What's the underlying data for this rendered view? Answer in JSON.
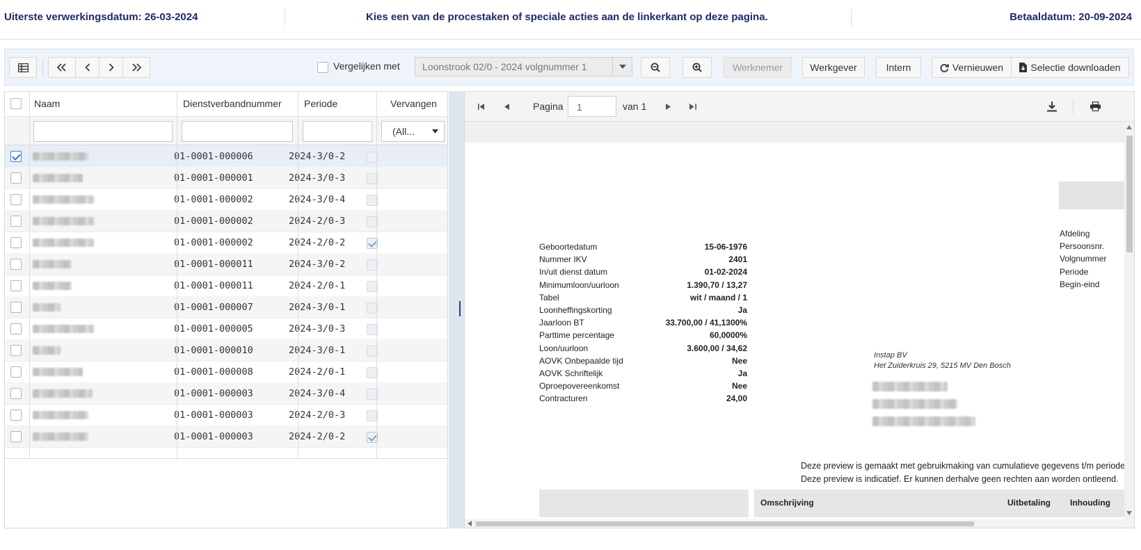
{
  "header": {
    "left": "Uiterste verwerkingsdatum: 26-03-2024",
    "center": "Kies een van de procestaken of speciale acties aan de linkerkant op deze pagina.",
    "right": "Betaaldatum: 20-09-2024"
  },
  "toolbar": {
    "compare_label": "Vergelijken met",
    "compare_select": "Loonstrook 02/0 - 2024 volgnummer 1",
    "werknemer": "Werknemer",
    "werkgever": "Werkgever",
    "intern": "Intern",
    "vernieuwen": "Vernieuwen",
    "download": "Selectie downloaden"
  },
  "grid": {
    "columns": [
      "Naam",
      "Dienstverbandnummer",
      "Periode",
      "Vervangen"
    ],
    "filter_vervangen": "(All...",
    "rows": [
      {
        "dvn": "01-0001-000006",
        "periode": "2024-3/0-2",
        "selected": true,
        "vervangen": false
      },
      {
        "dvn": "01-0001-000001",
        "periode": "2024-3/0-3",
        "selected": false,
        "vervangen": false
      },
      {
        "dvn": "01-0001-000002",
        "periode": "2024-3/0-4",
        "selected": false,
        "vervangen": false
      },
      {
        "dvn": "01-0001-000002",
        "periode": "2024-2/0-3",
        "selected": false,
        "vervangen": false
      },
      {
        "dvn": "01-0001-000002",
        "periode": "2024-2/0-2",
        "selected": false,
        "vervangen": true
      },
      {
        "dvn": "01-0001-000011",
        "periode": "2024-3/0-2",
        "selected": false,
        "vervangen": false
      },
      {
        "dvn": "01-0001-000011",
        "periode": "2024-2/0-1",
        "selected": false,
        "vervangen": false
      },
      {
        "dvn": "01-0001-000007",
        "periode": "2024-3/0-1",
        "selected": false,
        "vervangen": false
      },
      {
        "dvn": "01-0001-000005",
        "periode": "2024-3/0-3",
        "selected": false,
        "vervangen": false
      },
      {
        "dvn": "01-0001-000010",
        "periode": "2024-3/0-1",
        "selected": false,
        "vervangen": false
      },
      {
        "dvn": "01-0001-000008",
        "periode": "2024-2/0-1",
        "selected": false,
        "vervangen": false
      },
      {
        "dvn": "01-0001-000003",
        "periode": "2024-3/0-4",
        "selected": false,
        "vervangen": false
      },
      {
        "dvn": "01-0001-000003",
        "periode": "2024-2/0-3",
        "selected": false,
        "vervangen": false
      },
      {
        "dvn": "01-0001-000003",
        "periode": "2024-2/0-2",
        "selected": false,
        "vervangen": true
      }
    ]
  },
  "viewer": {
    "page_label": "Pagina",
    "page_value": "1",
    "page_of": "van 1",
    "fields": [
      {
        "label": "Geboortedatum",
        "value": "15-06-1976"
      },
      {
        "label": "Nummer IKV",
        "value": "2401"
      },
      {
        "label": "In/uit dienst datum",
        "value": "01-02-2024"
      },
      {
        "label": "Minimumloon/uurloon",
        "value": "1.390,70 / 13,27"
      },
      {
        "label": "Tabel",
        "value": "wit / maand / 1"
      },
      {
        "label": "Loonheffingskorting",
        "value": "Ja"
      },
      {
        "label": "Jaarloon BT",
        "value": "33.700,00 / 41,1300%"
      },
      {
        "label": "Parttime percentage",
        "value": "60,0000%"
      },
      {
        "label": "Loon/uurloon",
        "value": "3.600,00 / 34,62"
      },
      {
        "label": "AOVK Onbepaalde tijd",
        "value": "Nee"
      },
      {
        "label": "AOVK Schriftelijk",
        "value": "Ja"
      },
      {
        "label": "Oproepovereenkomst",
        "value": "Nee"
      },
      {
        "label": "Contracturen",
        "value": "24,00"
      }
    ],
    "right_labels": [
      "Afdeling",
      "Persoonsnr.",
      "Volgnummer",
      "Periode",
      "Begin-eind"
    ],
    "company_name": "Instap BV",
    "company_address": "Het Zuiderkruis 29, 5215 MV Den Bosch",
    "note1": "Deze preview is gemaakt met gebruikmaking van cumulatieve gegevens t/m periode",
    "note2": "Deze preview is indicatief. Er kunnen derhalve geen rechten aan worden ontleend.",
    "table_headers": [
      "Omschrijving",
      "Uitbetaling",
      "Inhouding"
    ]
  }
}
